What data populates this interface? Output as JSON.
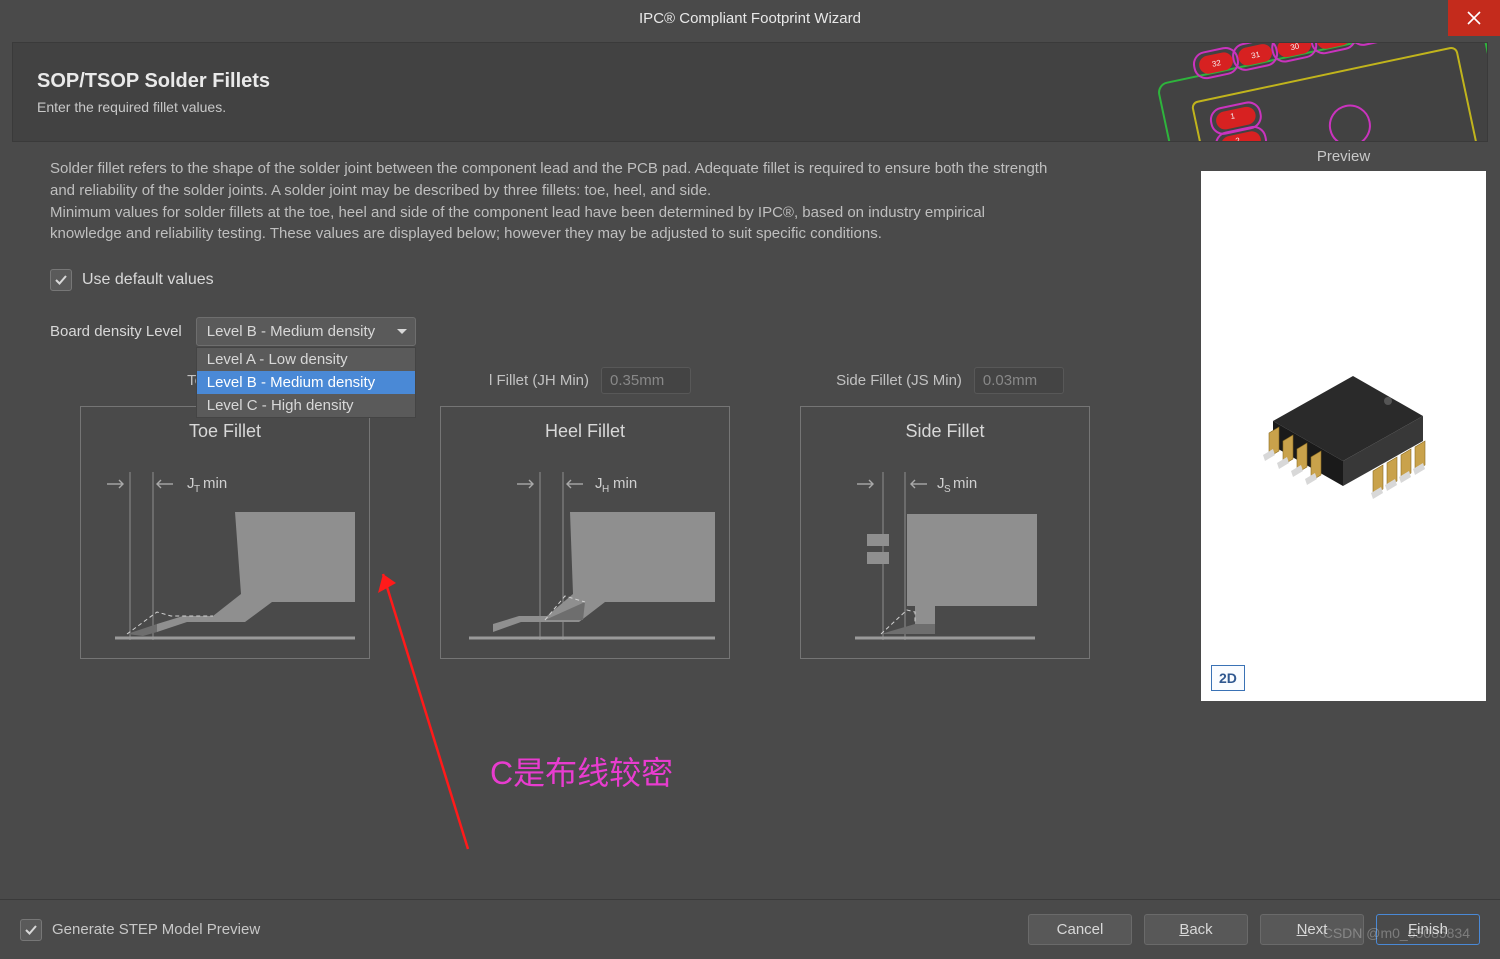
{
  "window": {
    "title": "IPC® Compliant Footprint Wizard"
  },
  "header": {
    "title": "SOP/TSOP Solder Fillets",
    "subtitle": "Enter the required fillet values."
  },
  "description": "Solder fillet refers to the shape of the solder joint between the component lead and the PCB pad. Adequate fillet is required to ensure both the strength and reliability of the solder joints. A solder joint may be described by three fillets: toe, heel, and side.\nMinimum values for solder fillets at the toe, heel and side of the component lead have been determined by IPC®, based on industry empirical knowledge and reliability testing. These values are displayed below; however they may be adjusted to suit specific conditions.",
  "defaults": {
    "checkbox_label": "Use default values",
    "checked": true
  },
  "density": {
    "label": "Board density Level",
    "selected": "Level B - Medium density",
    "options": [
      {
        "label": "Level A - Low density"
      },
      {
        "label": "Level B - Medium density",
        "selected": true
      },
      {
        "label": "Level C - High density"
      }
    ]
  },
  "fillets": {
    "toe": {
      "field_label": "Toe Fillet (JT Min)",
      "diagram_title": "Toe Fillet",
      "dim_label": "J_T min"
    },
    "heel": {
      "field_label": "Heel Fillet (JH Min)",
      "value": "0.35mm",
      "diagram_title": "Heel Fillet",
      "dim_label": "J_H min"
    },
    "side": {
      "field_label": "Side Fillet (JS Min)",
      "value": "0.03mm",
      "diagram_title": "Side Fillet",
      "dim_label": "J_S min"
    }
  },
  "annotation": {
    "text": "C是布线较密"
  },
  "preview": {
    "label": "Preview",
    "toggle": "2D"
  },
  "footer": {
    "generate_label": "Generate STEP Model Preview",
    "buttons": {
      "cancel": "Cancel",
      "back": "Back",
      "next": "Next",
      "finish": "Finish"
    }
  },
  "watermark": "CSDN @m0_65085834"
}
